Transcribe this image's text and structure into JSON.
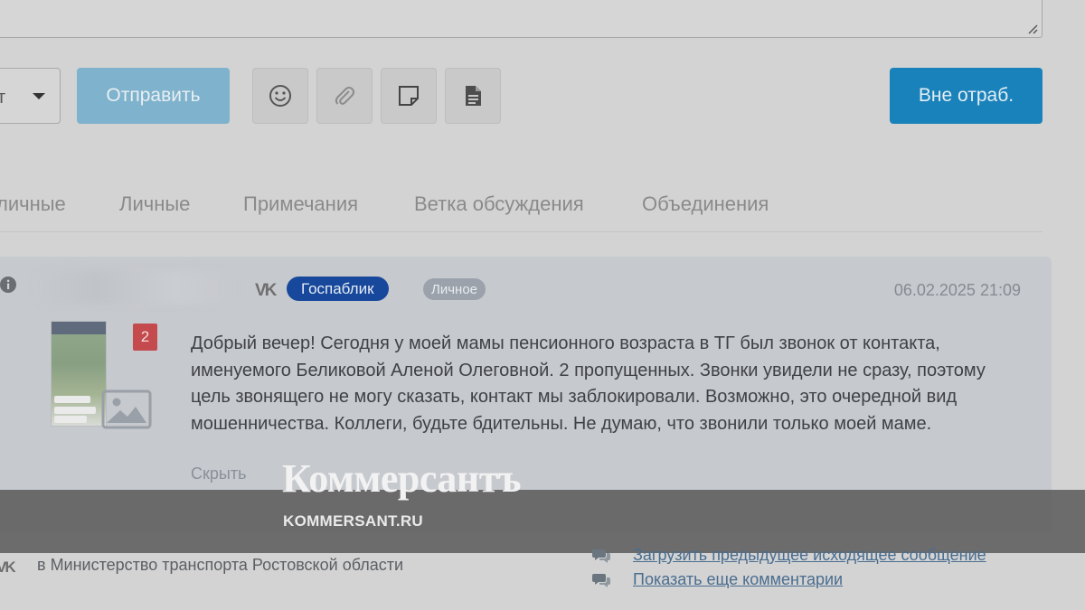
{
  "toolbar": {
    "select_value": "т",
    "send_label": "Отправить",
    "away_label": "Вне отраб.",
    "tools": [
      "smiley-icon",
      "paperclip-icon",
      "sticky-note-icon",
      "document-icon"
    ]
  },
  "tabs": [
    "личные",
    "Личные",
    "Примечания",
    "Ветка обсуждения",
    "Объединения"
  ],
  "message": {
    "source": "vk",
    "badge_source": "Госпаблик",
    "badge_type": "Личное",
    "datetime": "06.02.2025 21:09",
    "attachment_count": "2",
    "text": "Добрый вечер! Сегодня у моей мамы пенсионного возраста в ТГ был звонок от контакта, именуемого Беликовой Аленой Олеговной. 2 пропущенных. Звонки увидели не сразу, поэтому цель звонящего не могу сказать, контакт мы заблокировали. Возможно, это очередной вид мошенничества. Коллеги, будьте бдительны. Не думаю, что звонили только моей маме.",
    "hide_label": "Скрыть"
  },
  "footer": {
    "recipient": "в Министерство транспорта Ростовской области",
    "load_prev_link": "Загрузить предыдущее исходящее сообщение",
    "more_comments_link": "Показать еще комментарии"
  },
  "watermark": {
    "logo": "Коммерсантъ",
    "site": "KOMMERSANT.RU"
  },
  "colors": {
    "send_button": "#7fb2cc",
    "away_button": "#1a82ba",
    "badge_gospablik": "#17489b",
    "badge_count": "#c44a4d"
  }
}
